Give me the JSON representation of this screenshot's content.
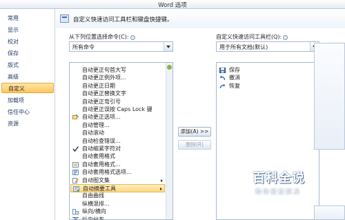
{
  "window": {
    "title": "Word 选项"
  },
  "nav": {
    "items": [
      {
        "label": "常用"
      },
      {
        "label": "显示"
      },
      {
        "label": "校对"
      },
      {
        "label": "保存"
      },
      {
        "label": "版式"
      },
      {
        "label": "高级"
      },
      {
        "label": "自定义",
        "active": true
      },
      {
        "label": "加载项"
      },
      {
        "label": "信任中心"
      },
      {
        "label": "资源"
      }
    ]
  },
  "header": {
    "text": "自定义快速访问工具栏和键盘快捷键。"
  },
  "left": {
    "label": "从下列位置选择命令(C):",
    "info": "ⓘ",
    "combo_value": "所有命令",
    "commands": [
      {
        "label": "自动更正句首大写",
        "icon": ""
      },
      {
        "label": "自动更正例外项...",
        "icon": ""
      },
      {
        "label": "自动更正日期",
        "icon": ""
      },
      {
        "label": "自动更正替换文字",
        "icon": ""
      },
      {
        "label": "自动更正弯引号",
        "icon": ""
      },
      {
        "label": "自动更正误按 Caps Lock 键",
        "icon": ""
      },
      {
        "label": "自动更正选项...",
        "icon": "autocorrect-options-icon"
      },
      {
        "label": "自动管理...",
        "icon": ""
      },
      {
        "label": "自动滚动",
        "icon": ""
      },
      {
        "label": "自动检查错误...",
        "icon": ""
      },
      {
        "label": "自动缩紧字符对",
        "icon": "checkmark-icon"
      },
      {
        "label": "自动套用格式",
        "icon": ""
      },
      {
        "label": "自动套用格式...",
        "icon": "autoformat-icon"
      },
      {
        "label": "自动套用格式选项...",
        "icon": "autoformat-options-icon"
      },
      {
        "label": "自动图文集",
        "icon": "autotext-icon",
        "submenu": true
      },
      {
        "label": "自动摘要工具",
        "icon": "autosummary-icon",
        "submenu": true,
        "selected": true
      },
      {
        "label": "自由曲线",
        "icon": ""
      },
      {
        "label": "纵横混排...",
        "icon": ""
      },
      {
        "label": "纵向/横向",
        "icon": "orientation-icon"
      },
      {
        "label": "纵向分布",
        "icon": "distribute-vertical-icon"
      }
    ]
  },
  "middle": {
    "add_button": "添加(A) >>",
    "remove_button": "删除(R)"
  },
  "right": {
    "label": "自定义快速访问工具栏(Q):",
    "info": "ⓘ",
    "combo_value": "用于所有文档(默认)",
    "items": [
      {
        "label": "保存",
        "icon": "save-icon"
      },
      {
        "label": "撤消",
        "icon": "undo-icon",
        "submenu": true
      },
      {
        "label": "恢复",
        "icon": "redo-icon"
      }
    ]
  },
  "watermark": {
    "title": "百科全说",
    "subtitle": "助你轻松解决"
  },
  "colors": {
    "selection": "#ffd780",
    "nav_active": "#ffc65a",
    "accent": "#3d6ea8"
  }
}
